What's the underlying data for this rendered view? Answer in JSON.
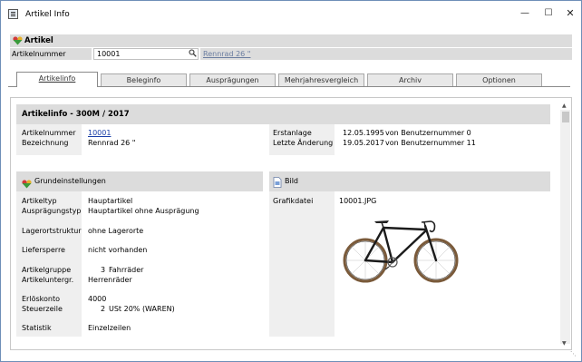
{
  "window": {
    "title": "Artikel Info"
  },
  "artikel_bar": {
    "label": "Artikel"
  },
  "artikelnummer": {
    "label": "Artikelnummer",
    "value": "10001",
    "linked_name": "Rennrad 26 \""
  },
  "tabs": [
    {
      "label": "Artikelinfo",
      "active": true
    },
    {
      "label": "Beleginfo",
      "active": false
    },
    {
      "label": "Ausprägungen",
      "active": false
    },
    {
      "label": "Mehrjahresvergleich",
      "active": false
    },
    {
      "label": "Archiv",
      "active": false
    },
    {
      "label": "Optionen",
      "active": false
    }
  ],
  "info_header": {
    "title": "Artikelinfo - 300M / 2017"
  },
  "left_info": {
    "artikelnummer_label": "Artikelnummer",
    "artikelnummer_value": "10001",
    "bezeichnung_label": "Bezeichnung",
    "bezeichnung_value": "Rennrad 26 \""
  },
  "right_info": {
    "erstanlage_label": "Erstanlage",
    "erstanlage_date": "12.05.1995",
    "erstanlage_by": "von Benutzernummer 0",
    "aenderung_label": "Letzte Änderung",
    "aenderung_date": "19.05.2017",
    "aenderung_by": "von Benutzernummer 11"
  },
  "grundeinstellungen": {
    "title": "Grundeinstellungen",
    "artikeltyp_label": "Artikeltyp",
    "artikeltyp_value": "Hauptartikel",
    "auspraegungstyp_label": "Ausprägungstyp",
    "auspraegungstyp_value": "Hauptartikel ohne Ausprägung",
    "lagerortstruktur_label": "Lagerortstruktur",
    "lagerortstruktur_value": "ohne Lagerorte",
    "liefersperre_label": "Liefersperre",
    "liefersperre_value": "nicht vorhanden",
    "artikelgruppe_label": "Artikelgruppe",
    "artikelgruppe_num": "3",
    "artikelgruppe_value": "Fahrräder",
    "artikeluntergr_label": "Artikeluntergr.",
    "artikeluntergr_value": "Herrenräder",
    "erloeskonto_label": "Erlöskonto",
    "erloeskonto_value": "4000",
    "steuerzeile_label": "Steuerzeile",
    "steuerzeile_num": "2",
    "steuerzeile_value": "USt 20% (WAREN)",
    "statistik_label": "Statistik",
    "statistik_value": "Einzelzeilen"
  },
  "bild": {
    "title": "Bild",
    "grafikdatei_label": "Grafikdatei",
    "grafikdatei_value": "10001.JPG"
  },
  "icons": {
    "app": "window-icon",
    "artikel": "heart-icon",
    "search": "search-icon",
    "bild": "image-file-icon"
  }
}
